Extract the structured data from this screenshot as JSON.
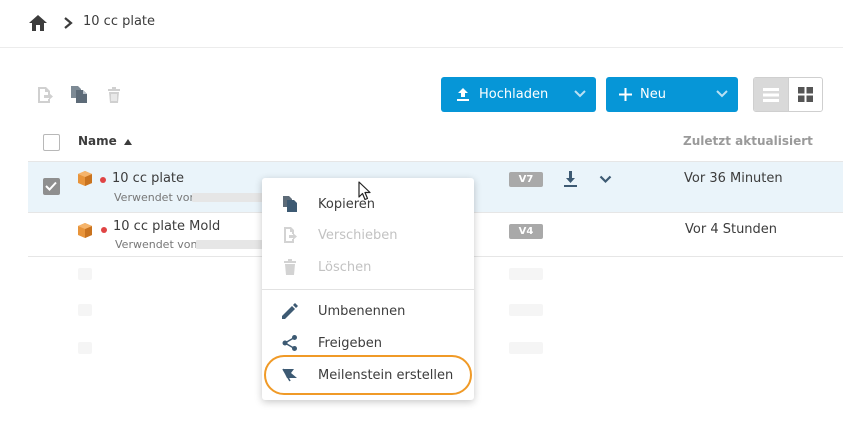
{
  "breadcrumb": {
    "home_icon": "home-icon",
    "separator_icon": "chevron-right-icon",
    "current": "10 cc plate"
  },
  "toolbar": {
    "move_icon": "move-icon",
    "copy_icon": "copy-icon",
    "delete_icon": "trash-icon",
    "upload_label": "Hochladen",
    "new_label": "Neu",
    "view_list_icon": "list-view-icon",
    "view_grid_icon": "grid-view-icon"
  },
  "table": {
    "col_name": "Name",
    "col_updated": "Zuletzt aktualisiert",
    "rows": [
      {
        "name": "10 cc plate",
        "used_by": "Verwendet von",
        "version": "V7",
        "updated": "Vor 36 Minuten",
        "selected": true
      },
      {
        "name": "10 cc plate Mold",
        "used_by": "Verwendet von",
        "version": "V4",
        "updated": "Vor 4 Stunden",
        "selected": false
      }
    ]
  },
  "context_menu": {
    "items": [
      {
        "label": "Kopieren",
        "icon": "copy-icon",
        "enabled": true
      },
      {
        "label": "Verschieben",
        "icon": "move-icon",
        "enabled": false
      },
      {
        "label": "Löschen",
        "icon": "trash-icon",
        "enabled": false
      },
      {
        "label": "Umbenennen",
        "icon": "pencil-icon",
        "enabled": true
      },
      {
        "label": "Freigeben",
        "icon": "share-icon",
        "enabled": true
      },
      {
        "label": "Meilenstein erstellen",
        "icon": "flag-icon",
        "enabled": true
      }
    ]
  },
  "colors": {
    "primary": "#0696d7",
    "highlight": "#f09a27",
    "status_dot": "#e04444",
    "file_icon": "#e8943a"
  }
}
